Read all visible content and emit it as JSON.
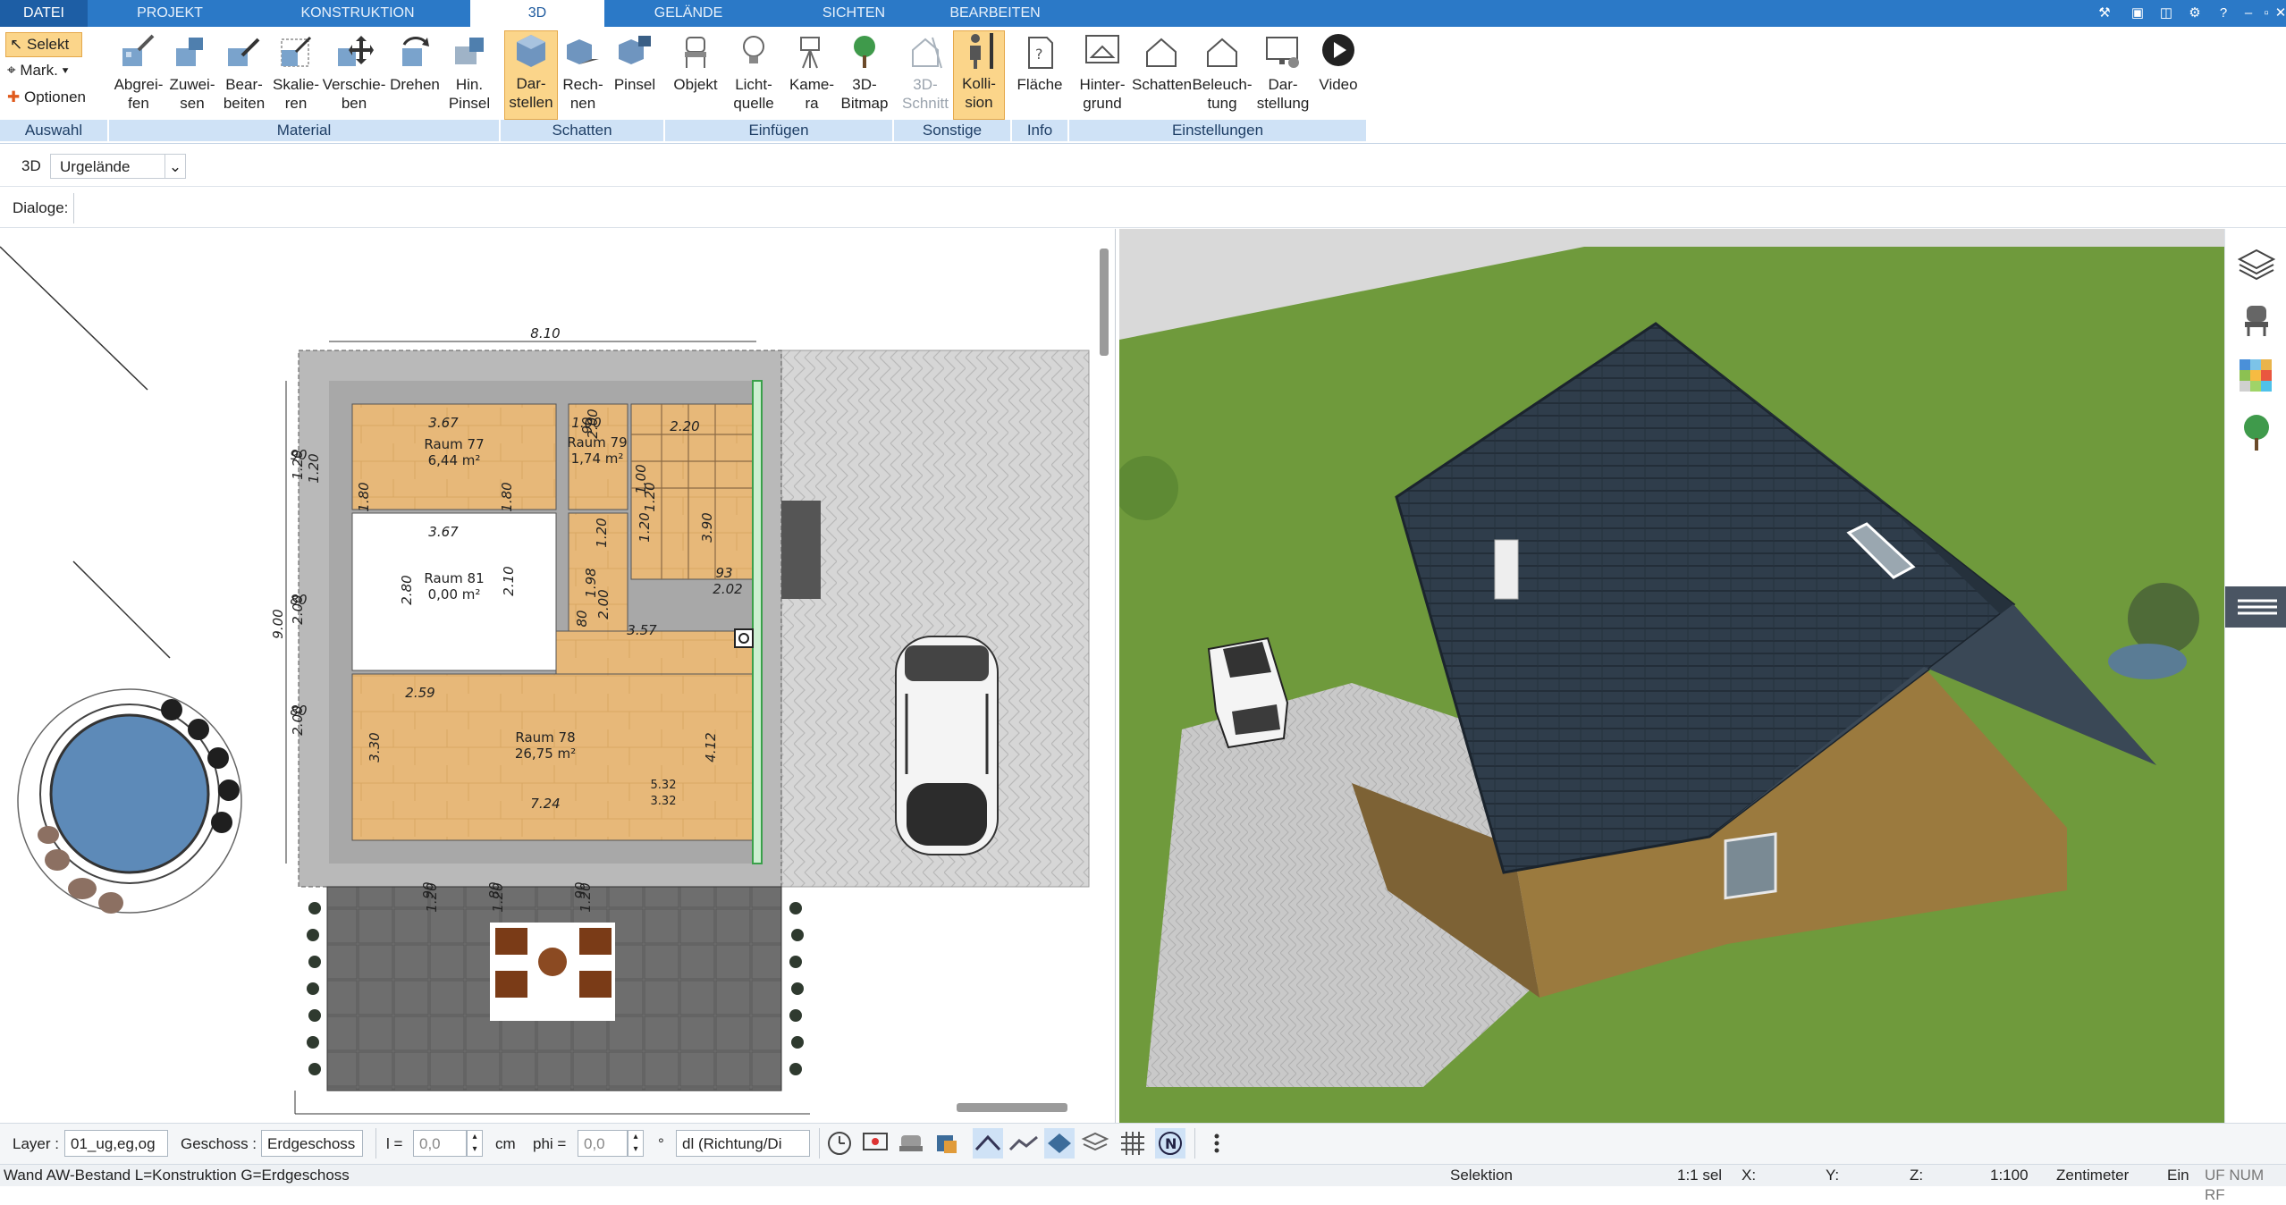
{
  "tabs": [
    {
      "label": "DATEI"
    },
    {
      "label": "PROJEKT"
    },
    {
      "label": "KONSTRUKTION"
    },
    {
      "label": "3D"
    },
    {
      "label": "GELÄNDE"
    },
    {
      "label": "SICHTEN"
    },
    {
      "label": "BEARBEITEN"
    }
  ],
  "ribbon": {
    "auswahl": {
      "select": "Selekt",
      "mark": "Mark.",
      "options": "Optionen",
      "group": "Auswahl"
    },
    "material": {
      "group": "Material",
      "buttons": [
        "Abgrei-\nfen",
        "Zuwei-\nsen",
        "Bear-\nbeiten",
        "Skalie-\nren",
        "Verschie-\nben",
        "Drehen",
        "Hin.\nPinsel"
      ]
    },
    "schatten": {
      "group": "Schatten",
      "buttons": [
        "Dar-\nstellen",
        "Rech-\nnen",
        "Pinsel"
      ]
    },
    "einfuegen": {
      "group": "Einfügen",
      "buttons": [
        "Objekt",
        "Licht-\nquelle",
        "Kame-\nra",
        "3D-\nBitmap"
      ]
    },
    "sonstige": {
      "group": "Sonstige",
      "buttons": [
        "3D-\nSchnitt",
        "Kolli-\nsion"
      ]
    },
    "info": {
      "group": "Info",
      "buttons": [
        "Fläche"
      ]
    },
    "einstellungen": {
      "group": "Einstellungen",
      "buttons": [
        "Hinter-\ngrund",
        "Schatten",
        "Beleuch-\ntung",
        "Dar-\nstellung",
        "Video"
      ]
    }
  },
  "view_row": {
    "mode": "3D",
    "selection": "Urgelände"
  },
  "dialog_row": {
    "label": "Dialoge:"
  },
  "plan": {
    "dims": [
      "8.10",
      "3.67",
      "1.00",
      "2.20",
      "3.67",
      "1.80",
      "1.80",
      "1.20",
      "2.80",
      "2.10",
      "3.57",
      "2.59",
      "7.24",
      "3.30",
      "4.12",
      "9.00",
      "8.10",
      "90",
      "1.20",
      "80",
      "2.00",
      "80",
      "2.00",
      "90",
      "2.00",
      "93",
      "2.02",
      "3.90",
      "1.98",
      "1.20",
      "1.20",
      "90",
      "1.20",
      "80",
      "1.20",
      "90",
      "1.20",
      "1.00",
      "1.20",
      "2.00",
      "80"
    ],
    "rooms": [
      {
        "name": "Raum 77",
        "area": "6,44 m²"
      },
      {
        "name": "Raum 79",
        "area": "1,74 m²"
      },
      {
        "name": "Raum 81",
        "area": "0,00 m²"
      },
      {
        "name": "Raum 78",
        "area": "26,75 m²"
      }
    ],
    "small_labels": [
      "3.32",
      "5.32"
    ]
  },
  "bottom": {
    "layer_label": "Layer :",
    "layer_value": "01_ug,eg,og",
    "geschoss_label": "Geschoss :",
    "geschoss_value": "Erdgeschoss",
    "l_label": "l =",
    "l_value": "0,0",
    "l_unit": "cm",
    "phi_label": "phi =",
    "phi_value": "0,0",
    "phi_unit": "°",
    "dl_value": "dl (Richtung/Di"
  },
  "status": {
    "left": "Wand AW-Bestand L=Konstruktion G=Erdgeschoss",
    "mode": "Selektion",
    "scale_sel": "1:1 sel",
    "x": "X:",
    "y": "Y:",
    "z": "Z:",
    "scale": "1:100",
    "unit": "Zentimeter",
    "ein": "Ein",
    "flags": "UF NUM RF"
  },
  "colors": {
    "accent": "#2b79c7",
    "ribbon_group": "#cfe2f6",
    "highlight": "#fbd58a",
    "roof": "#2c3a48",
    "wall": "#a07a45",
    "grass": "#6f9a3c"
  }
}
